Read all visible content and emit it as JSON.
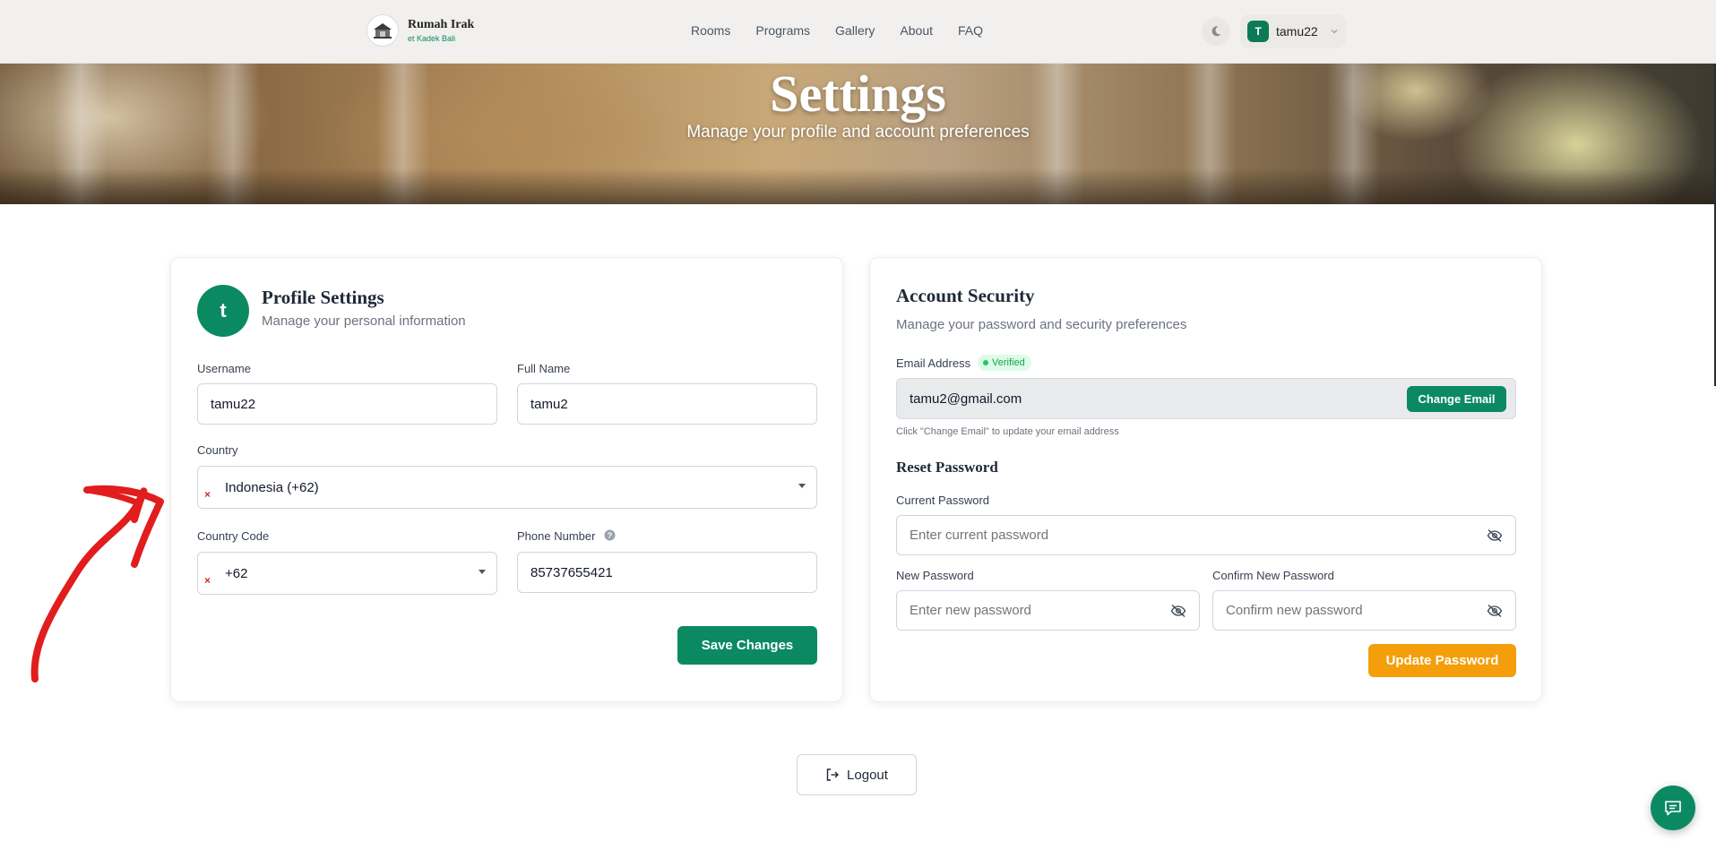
{
  "brand": {
    "name": "Rumah Irak",
    "subtitle": "et Kadek Bali"
  },
  "nav": {
    "links": [
      "Rooms",
      "Programs",
      "Gallery",
      "About",
      "FAQ"
    ]
  },
  "user": {
    "initial": "T",
    "username": "tamu22"
  },
  "hero": {
    "title": "Settings",
    "subtitle": "Manage your profile and account preferences"
  },
  "profile": {
    "avatar_initial": "t",
    "title": "Profile Settings",
    "subtitle": "Manage your personal information",
    "username_label": "Username",
    "username_value": "tamu22",
    "fullname_label": "Full Name",
    "fullname_value": "tamu2",
    "country_label": "Country",
    "country_value": "Indonesia (+62)",
    "country_code_label": "Country Code",
    "country_code_value": "+62",
    "phone_label": "Phone Number",
    "phone_value": "85737655421",
    "save_label": "Save Changes"
  },
  "security": {
    "title": "Account Security",
    "subtitle": "Manage your password and security preferences",
    "email_label": "Email Address",
    "verified_label": "Verified",
    "email_value": "tamu2@gmail.com",
    "change_email_label": "Change Email",
    "email_hint": "Click \"Change Email\" to update your email address",
    "reset_title": "Reset Password",
    "current_password_label": "Current Password",
    "current_password_placeholder": "Enter current password",
    "new_password_label": "New Password",
    "new_password_placeholder": "Enter new password",
    "confirm_password_label": "Confirm New Password",
    "confirm_password_placeholder": "Confirm new password",
    "update_label": "Update Password"
  },
  "logout": {
    "label": "Logout"
  },
  "colors": {
    "primary": "#0b8a62",
    "accent": "#f59e0b",
    "error": "#dc2626",
    "annotation": "#e11d1d"
  },
  "icons": [
    "logo-icon",
    "moon-icon",
    "chevron-down-icon",
    "help-icon",
    "eye-off-icon",
    "logout-icon",
    "chat-icon",
    "x-icon",
    "caret-down-icon"
  ]
}
